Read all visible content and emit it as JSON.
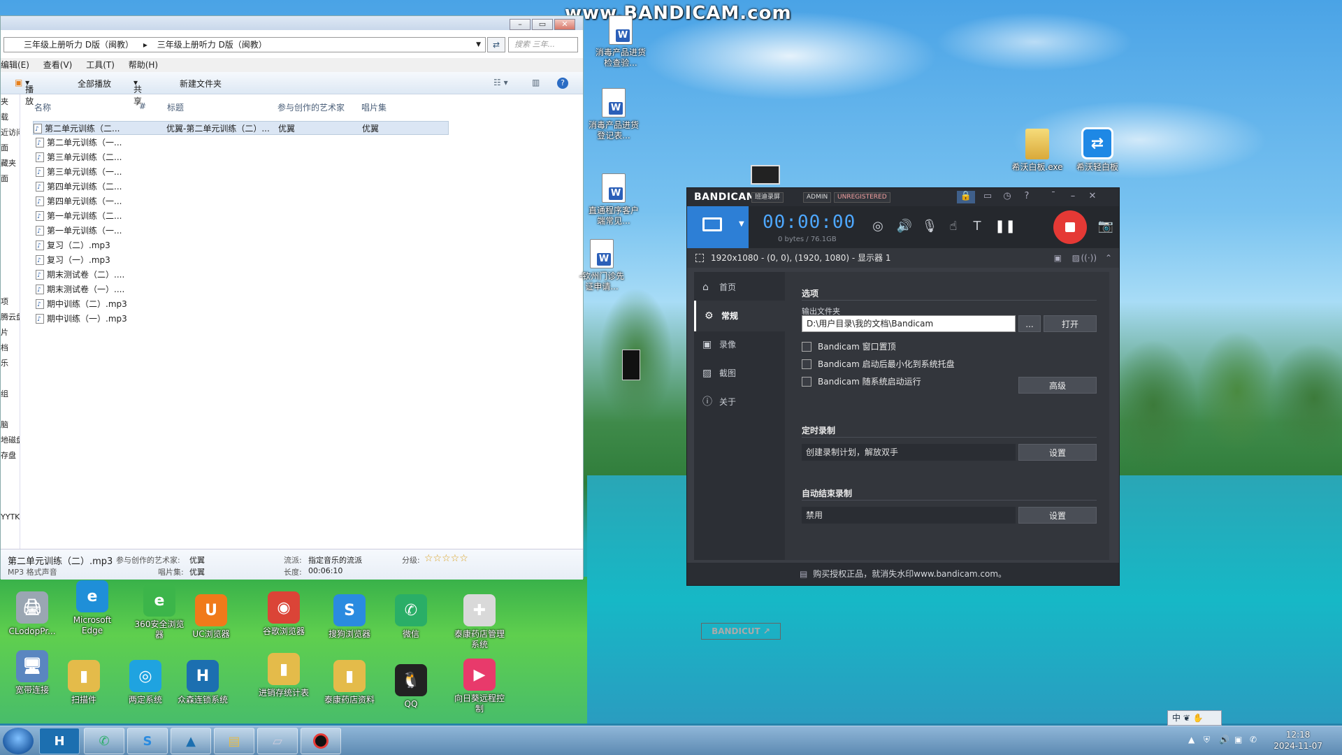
{
  "watermark": "www.BANDICAM.com",
  "explorer": {
    "address": [
      "三年级上册听力 D版（闽教）",
      "三年级上册听力 D版（闽教）"
    ],
    "search_placeholder": "搜索 三年...",
    "menu": [
      "编辑(E)",
      "查看(V)",
      "工具(T)",
      "帮助(H)"
    ],
    "toolbar": {
      "play": "播放",
      "play_all": "全部播放",
      "share": "共享",
      "new_folder": "新建文件夹"
    },
    "nav": [
      "夹",
      "载",
      "近访问",
      "面",
      "藏夹",
      "面",
      "",
      "",
      "",
      "",
      "",
      "",
      "",
      "项",
      "腾云盘",
      "片",
      "档",
      "乐",
      "",
      "组",
      "",
      "脑",
      "地磁盘",
      "存盘（",
      "",
      "",
      "",
      "YYTK"
    ],
    "columns": {
      "name": "名称",
      "num": "#",
      "title": "标题",
      "artist": "参与创作的艺术家",
      "album": "唱片集"
    },
    "first_row": {
      "title": "优翼-第二单元训练（二）...",
      "artist": "优翼",
      "album": "优翼"
    },
    "files": [
      "第二单元训练（二...",
      "第二单元训练（一...",
      "第三单元训练（二...",
      "第三单元训练（一...",
      "第四单元训练（二...",
      "第四单元训练（一...",
      "第一单元训练（二...",
      "第一单元训练（一...",
      "复习（二）.mp3",
      "复习（一）.mp3",
      "期末测试卷（二）....",
      "期末测试卷（一）....",
      "期中训练（二）.mp3",
      "期中训练（一）.mp3"
    ],
    "details": {
      "filename": "第二单元训练（二）.mp3",
      "artist_label": "参与创作的艺术家:",
      "artist": "优翼",
      "type": "MP3 格式声音",
      "album_label": "唱片集:",
      "album": "优翼",
      "genre_label": "流派:",
      "genre": "指定音乐的流派",
      "length_label": "长度:",
      "length": "00:06:10",
      "rating_label": "分级:",
      "stars": "☆☆☆☆☆"
    }
  },
  "desktop_right": [
    {
      "label": "消毒产品进货检查验...",
      "icon": "word-icon"
    },
    {
      "label": "消毒产品进货登记表...",
      "icon": "word-icon"
    },
    {
      "label": "直通程序客户端常见...",
      "icon": "word-icon"
    },
    {
      "label": "-钦州门诊先证申请...",
      "icon": "word-icon"
    },
    {
      "label": "希沃白板.exe",
      "icon": "folder-icon"
    },
    {
      "label": "希沃轻白板",
      "icon": "seewo-icon"
    }
  ],
  "desktop_bottom": [
    {
      "label": "CLodopPr...",
      "color": "#9aa6b2",
      "glyph": "🖨"
    },
    {
      "label": "Microsoft Edge",
      "color": "#1f8fd8",
      "glyph": "e"
    },
    {
      "label": "360安全浏览器",
      "color": "#3cb54a",
      "glyph": "e"
    },
    {
      "label": "UC浏览器",
      "color": "#f07a1a",
      "glyph": "U"
    },
    {
      "label": "谷歌浏览器",
      "color": "#db4437",
      "glyph": "◉"
    },
    {
      "label": "搜狗浏览器",
      "color": "#2a8be0",
      "glyph": "S"
    },
    {
      "label": "微信",
      "color": "#2aae67",
      "glyph": "✆"
    },
    {
      "label": "泰康药店管理系统",
      "color": "#d9d9d9",
      "glyph": "✚"
    },
    {
      "label": "宽带连接",
      "color": "#5a86c0",
      "glyph": "🖥"
    },
    {
      "label": "扫描件",
      "color": "#e4bb4a",
      "glyph": "▮"
    },
    {
      "label": "两定系统",
      "color": "#1fa3e0",
      "glyph": "◎"
    },
    {
      "label": "众森连锁系统",
      "color": "#1c6fb0",
      "glyph": "H"
    },
    {
      "label": "进销存统计表",
      "color": "#e4bb4a",
      "glyph": "▮"
    },
    {
      "label": "泰康药店资料",
      "color": "#e4bb4a",
      "glyph": "▮"
    },
    {
      "label": "QQ",
      "color": "#222",
      "glyph": "🐧"
    },
    {
      "label": "向日葵远程控制",
      "color": "#e83a6b",
      "glyph": "▶"
    }
  ],
  "bandicam": {
    "brand": "BANDICAM",
    "tags": [
      "班迪录屏",
      "ADMIN",
      "UNREGISTERED"
    ],
    "time": "00:00:00",
    "size": "0 bytes / 76.1GB",
    "region": "1920x1080 - (0, 0), (1920, 1080) - 显示器 1",
    "nav": [
      {
        "label": "首页",
        "icon": "home-icon"
      },
      {
        "label": "常规",
        "icon": "gear-icon"
      },
      {
        "label": "录像",
        "icon": "video-icon"
      },
      {
        "label": "截图",
        "icon": "image-icon"
      },
      {
        "label": "关于",
        "icon": "info-icon"
      }
    ],
    "section_options": "选项",
    "output_label": "输出文件夹",
    "output_path": "D:\\用户目录\\我的文档\\Bandicam",
    "browse": "...",
    "open": "打开",
    "checks": [
      "Bandicam 窗口置顶",
      "Bandicam 启动后最小化到系统托盘",
      "Bandicam 随系统启动运行"
    ],
    "advanced": "高级",
    "section_timer": "定时录制",
    "timer_text": "创建录制计划，解放双手",
    "timer_btn": "设置",
    "section_autostop": "自动结束录制",
    "autostop_text": "禁用",
    "autostop_btn": "设置",
    "bandicut": "BANDICUT ↗",
    "footer": "购买授权正品，就消失水印www.bandicam.com。"
  },
  "taskbar": {
    "ime": "中 ❦ ✋",
    "time": "12:18",
    "date": "2024-11-07"
  }
}
